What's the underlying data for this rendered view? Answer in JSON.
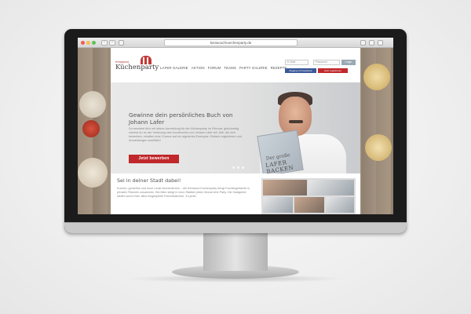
{
  "browser": {
    "url": "kenwood-kuechenparty.de",
    "back_label": "‹",
    "forward_label": "›"
  },
  "site": {
    "logo_small": "Kenwood",
    "logo_main": "Küchenparty",
    "nav": [
      "Lafer Galerie",
      "Aktion",
      "Forum",
      "Teams",
      "Party Galerie",
      "Rezepte"
    ],
    "login": {
      "email_placeholder": "E-Mail",
      "password_placeholder": "Passwort",
      "button": "Login",
      "facebook_button": "Zugang mit Facebook",
      "register_button": "Jetzt registrieren"
    },
    "hero": {
      "title": "Gewinne dein persönliches Buch von Johann Lafer",
      "text": "Du bewirbst dich mit deiner Anmeldung für die Küchenparty im Februar, gleichzeitig nimmst du an der Verlosung des Kochbuches von Johann Lafer teil. Alle, die sich bewerben, erhalten eine Chance auf ein signiertes Exemplar. Einfach registrieren und Anmeldungen ausfüllen!",
      "button": "Jetzt bewerben",
      "book_title_1": "Der große",
      "book_title_2": "LAFER BACKEN"
    },
    "lower": {
      "title": "Sei in deiner Stadt dabei!",
      "text": "Kochen, genießen und neue Leute kennenlernen – die Kenwood Küchenparty bringt Kochbegeisterte in privaten Räumen zusammen. Bis März steigt in neun Städten jeden Monat eine Party. Die Gastgeber stellen schon fest: alles eingespielte Freundeskreise. Zu jeder"
    },
    "colors": {
      "accent_red": "#c0282b",
      "facebook_blue": "#3b5998"
    }
  }
}
